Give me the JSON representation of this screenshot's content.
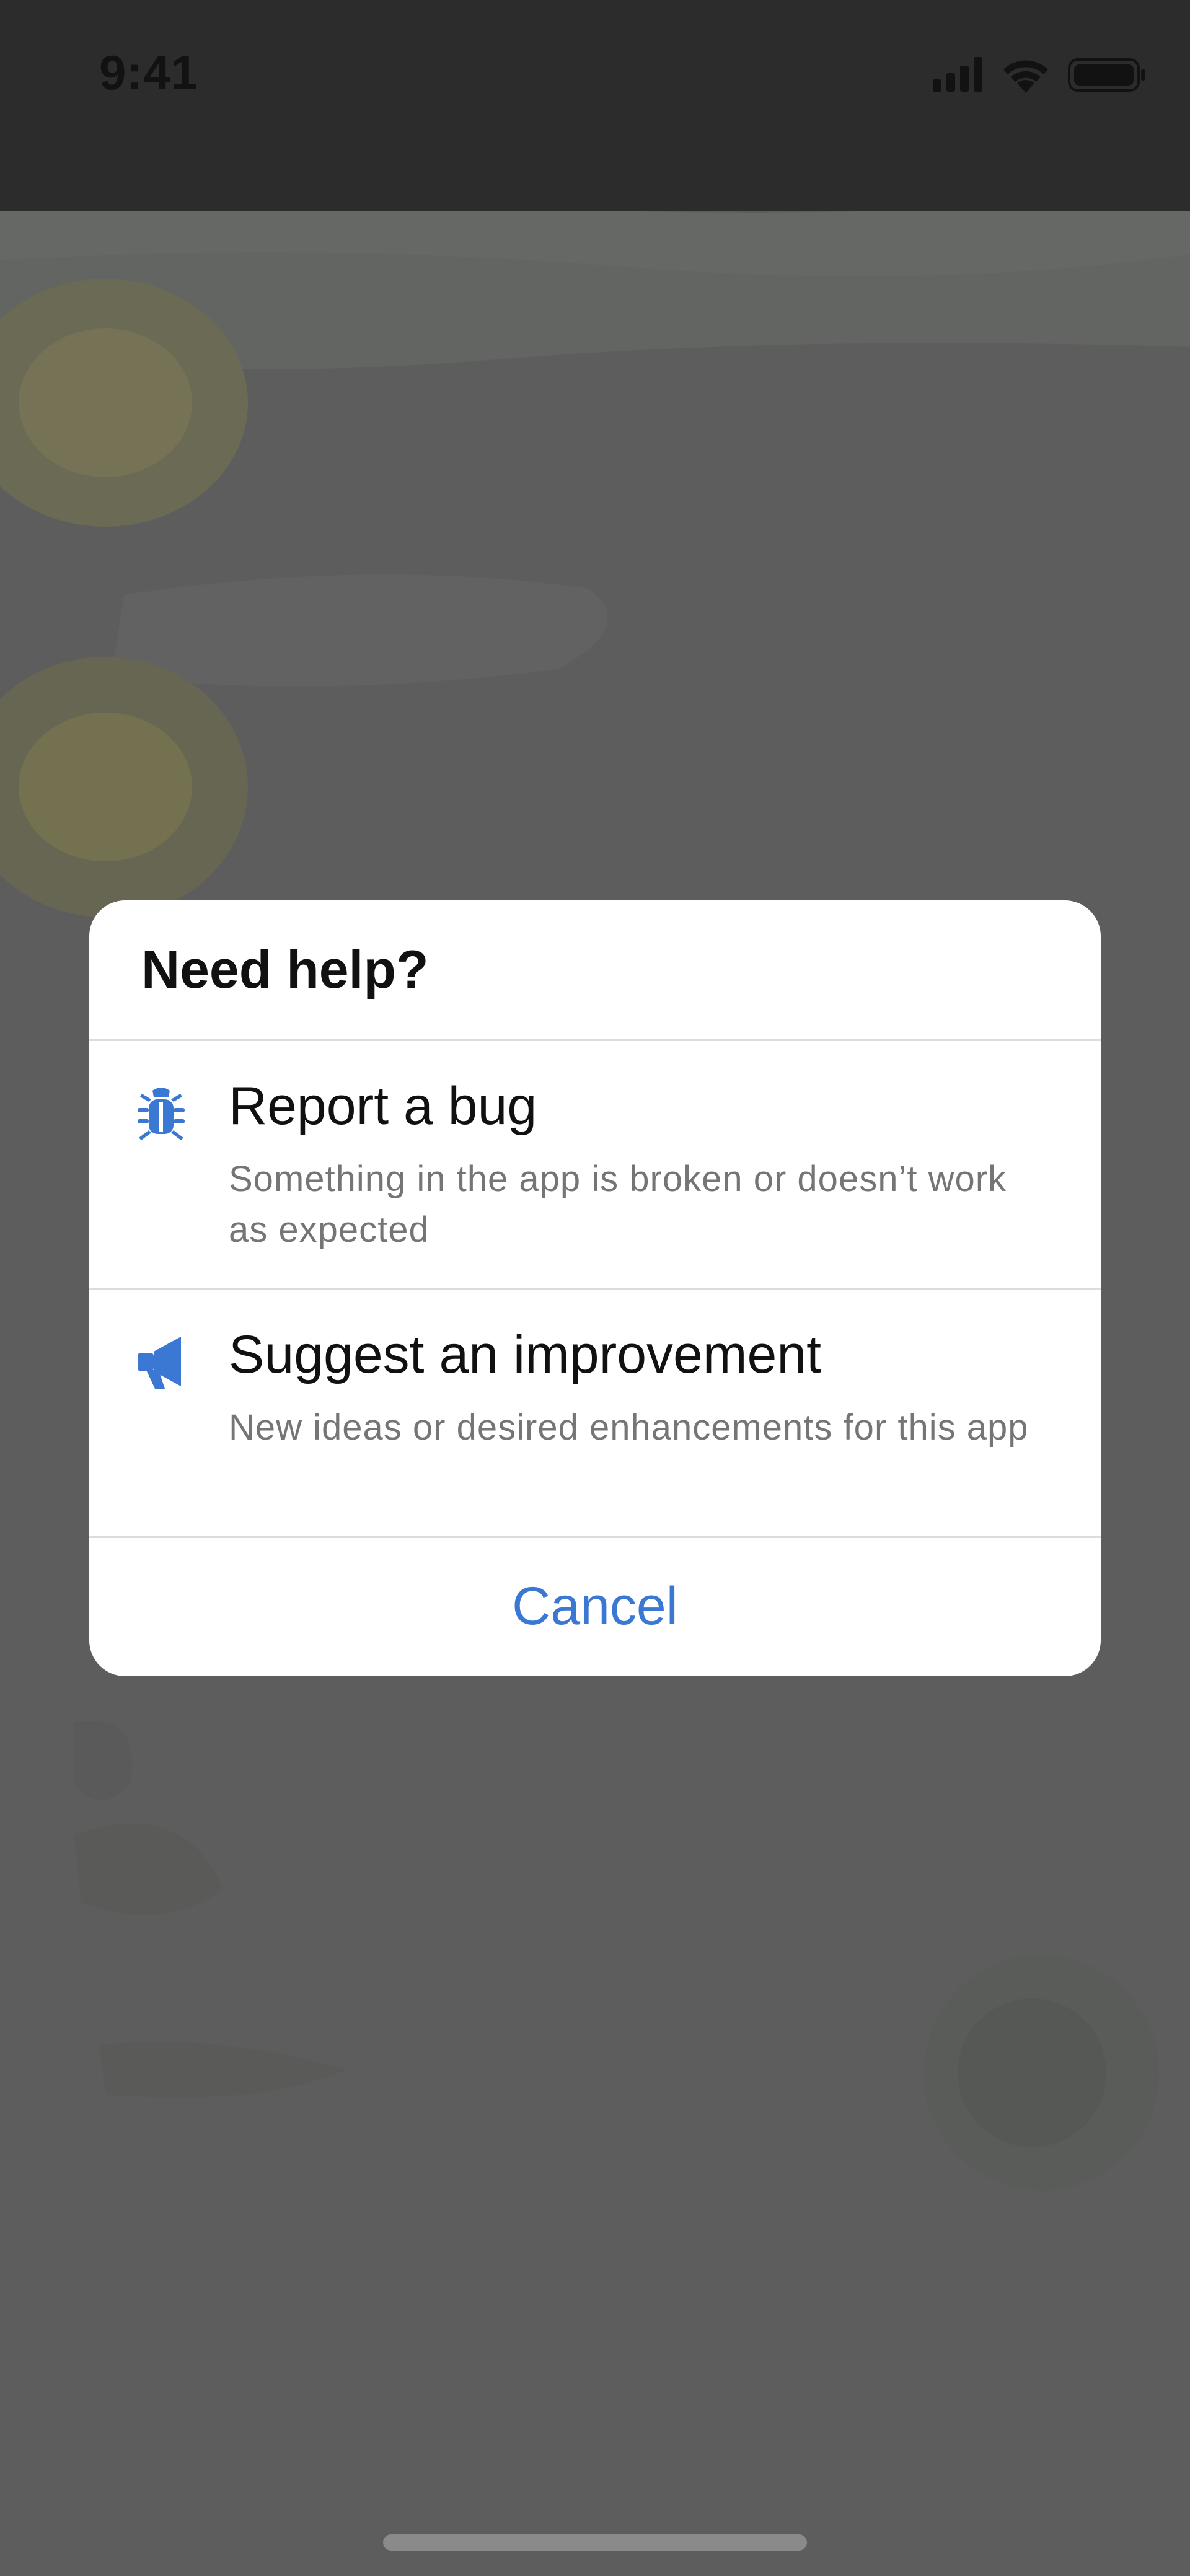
{
  "status_bar": {
    "time": "9:41",
    "icons": [
      "cellular-signal-icon",
      "wifi-icon",
      "battery-icon"
    ]
  },
  "dialog": {
    "title": "Need help?",
    "options": [
      {
        "icon": "bug-icon",
        "title": "Report a bug",
        "description": "Something in the app is broken or doesn’t work as expected"
      },
      {
        "icon": "megaphone-icon",
        "title": "Suggest an improvement",
        "description": "New ideas or desired enhancements for this app"
      }
    ],
    "cancel_label": "Cancel"
  },
  "colors": {
    "accent": "#3b78d4",
    "scrim": "#5d5d5d",
    "dialog_bg": "#ffffff",
    "secondary_text": "#757575"
  }
}
